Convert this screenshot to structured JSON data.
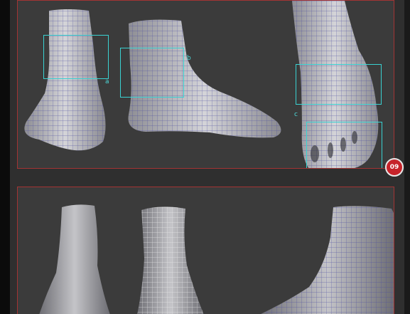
{
  "callouts": {
    "a": {
      "label": "a"
    },
    "b": {
      "label": "b"
    },
    "c": {
      "label": "c"
    }
  },
  "step_badge": {
    "label": "09"
  },
  "colors": {
    "frame": "#a33434",
    "callout": "#39d2d2",
    "badge": "#c6232a",
    "background": "#3b3b3b",
    "wireframe": "#4b4aa0"
  },
  "icons": {
    "views": [
      "foot-back-view",
      "foot-side-view",
      "foot-top-view",
      "foot-sculpt-smooth",
      "foot-sculpt-wireframe",
      "foot-closeup-wireframe"
    ]
  }
}
